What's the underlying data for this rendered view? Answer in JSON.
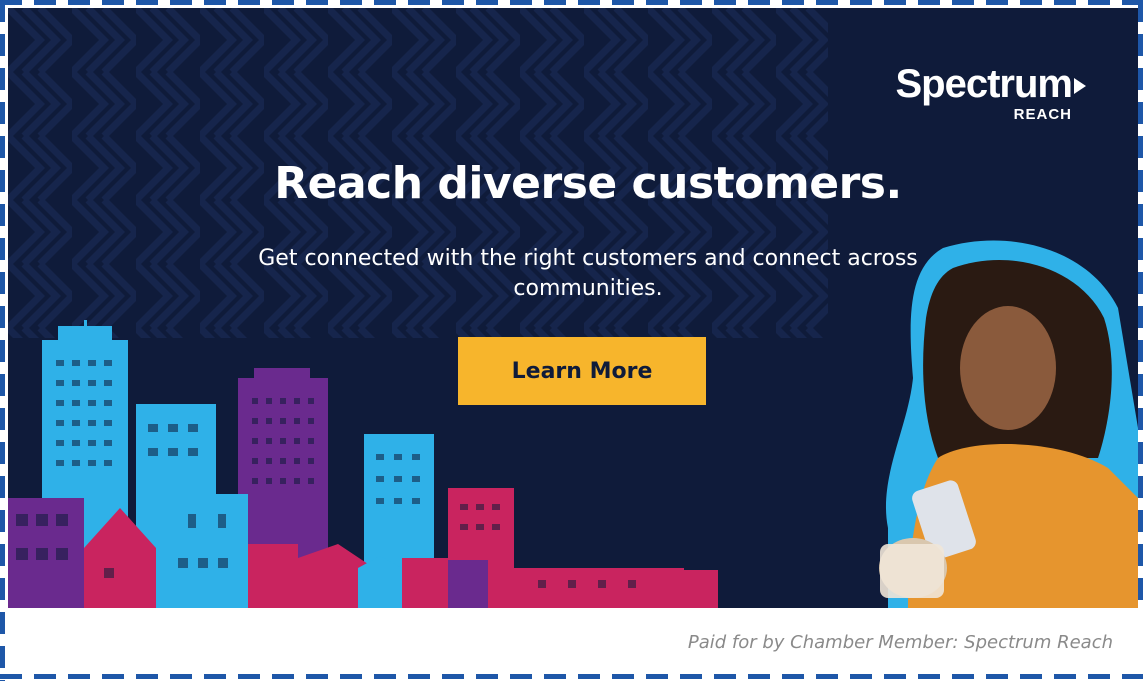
{
  "ad": {
    "logo": {
      "wordmark": "Spectrum",
      "sub": "REACH"
    },
    "headline": "Reach diverse customers.",
    "subline": "Get connected with the right customers and connect across communities.",
    "cta_label": "Learn More",
    "colors": {
      "background": "#0f1b3a",
      "cta": "#f7b52c",
      "accent_blue": "#2fb1e8",
      "accent_purple": "#6a2a8e",
      "accent_pink": "#c9245f",
      "border": "#1e57a8"
    }
  },
  "disclaimer": "Paid for by Chamber Member: Spectrum Reach"
}
